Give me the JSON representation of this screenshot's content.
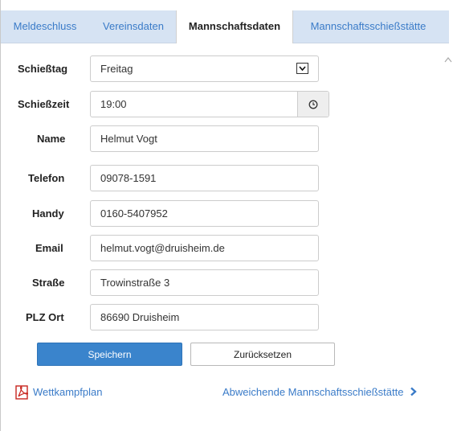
{
  "tabs": [
    {
      "label": "Meldeschluss",
      "active": false
    },
    {
      "label": "Vereinsdaten",
      "active": false
    },
    {
      "label": "Mannschaftsdaten",
      "active": true
    },
    {
      "label": "Mannschaftsschießstätte",
      "active": false
    }
  ],
  "form": {
    "schiesstag": {
      "label": "Schießtag",
      "value": "Freitag"
    },
    "schiesszeit": {
      "label": "Schießzeit",
      "value": "19:00"
    },
    "name": {
      "label": "Name",
      "value": "Helmut Vogt"
    },
    "telefon": {
      "label": "Telefon",
      "value": "09078-1591"
    },
    "handy": {
      "label": "Handy",
      "value": "0160-5407952"
    },
    "email": {
      "label": "Email",
      "value": "helmut.vogt@druisheim.de"
    },
    "strasse": {
      "label": "Straße",
      "value": "Trowinstraße 3"
    },
    "plz_ort": {
      "label": "PLZ Ort",
      "value": "86690 Druisheim"
    }
  },
  "buttons": {
    "save": "Speichern",
    "reset": "Zurücksetzen"
  },
  "links": {
    "wettkampfplan": "Wettkampfplan",
    "abweichende": "Abweichende Mannschaftsschießstätte"
  },
  "colors": {
    "accent": "#3a7bc8",
    "primary_button": "#3a84cc",
    "tabbar": "#d6e3f3"
  },
  "icons": {
    "pdf": "pdf-icon",
    "clock": "clock-icon",
    "chevron": "chevron-right-icon",
    "dropdown": "dropdown-arrow-icon"
  }
}
